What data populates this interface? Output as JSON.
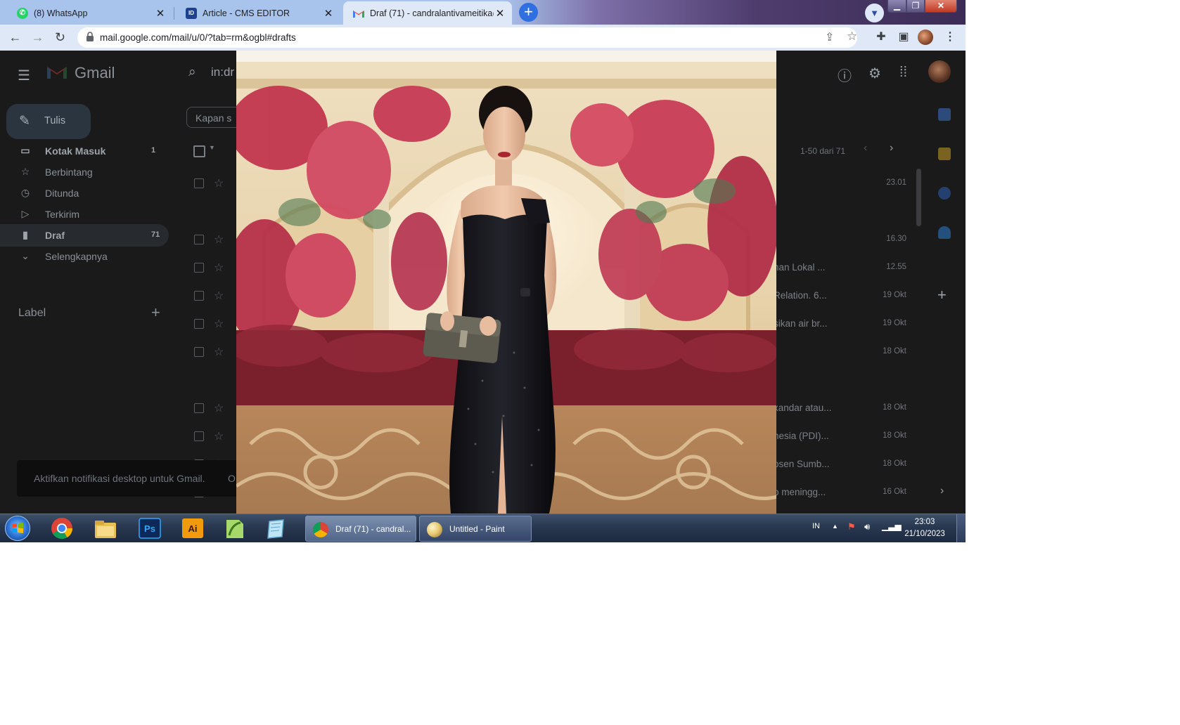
{
  "browser": {
    "tabs": [
      {
        "title": "(8) WhatsApp",
        "active": false,
        "favicon": "whatsapp-icon"
      },
      {
        "title": "Article - CMS EDITOR",
        "active": false,
        "favicon": "cms-icon"
      },
      {
        "title": "Draf (71) - candralantivameitika@",
        "active": true,
        "favicon": "gmail-icon"
      }
    ],
    "close_glyph": "✕",
    "new_tab_glyph": "+",
    "url": "mail.google.com/mail/u/0/?tab=rm&ogbl#drafts"
  },
  "gmail": {
    "product_name": "Gmail",
    "search_text": "in:dr",
    "compose_label": "Tulis",
    "nav": [
      {
        "label": "Kotak Masuk",
        "count": "1",
        "icon": "inbox-icon"
      },
      {
        "label": "Berbintang",
        "count": "",
        "icon": "star-icon"
      },
      {
        "label": "Ditunda",
        "count": "",
        "icon": "clock-icon"
      },
      {
        "label": "Terkirim",
        "count": "",
        "icon": "send-icon"
      },
      {
        "label": "Draf",
        "count": "71",
        "icon": "draft-icon"
      },
      {
        "label": "Selengkapnya",
        "count": "",
        "icon": "chevron-down-icon"
      }
    ],
    "label_header": "Label",
    "filter_chip": "Kapan s",
    "pagination": "1-50 dari 71",
    "rows": [
      {
        "snippet": "",
        "date": "23.01"
      },
      {
        "snippet": "",
        "date": "16.30"
      },
      {
        "snippet": "han Lokal ...",
        "date": "12.55"
      },
      {
        "snippet": "Relation. 6...",
        "date": "19 Okt"
      },
      {
        "snippet": "sikan air br...",
        "date": "19 Okt"
      },
      {
        "snippet": "",
        "date": "18 Okt"
      },
      {
        "snippet": "xandar atau...",
        "date": "18 Okt"
      },
      {
        "snippet": "nesia (PDI)...",
        "date": "18 Okt"
      },
      {
        "snippet": "osen Sumb...",
        "date": "18 Okt"
      },
      {
        "snippet": "o meningg...",
        "date": "16 Okt"
      }
    ],
    "toast_text": "Aktifkan notifikasi desktop untuk Gmail.",
    "toast_action": "O"
  },
  "taskbar": {
    "pinned": [
      "chrome-icon",
      "file-explorer-icon",
      "photoshop-icon",
      "illustrator-icon",
      "notepad-plus-icon",
      "notebook-icon"
    ],
    "ps_label": "Ps",
    "ai_label": "Ai",
    "windows": [
      {
        "label": "Draf (71) - candral...",
        "icon": "chrome-icon"
      },
      {
        "label": "Untitled - Paint",
        "icon": "paint-icon"
      }
    ],
    "language": "IN",
    "time": "23:03",
    "date": "21/10/2023"
  },
  "colors": {
    "tab_inactive": "#a9c4ec",
    "tab_active": "#dfe8f6",
    "gmail_red": "#ea4335",
    "taskbar": "#283850"
  }
}
